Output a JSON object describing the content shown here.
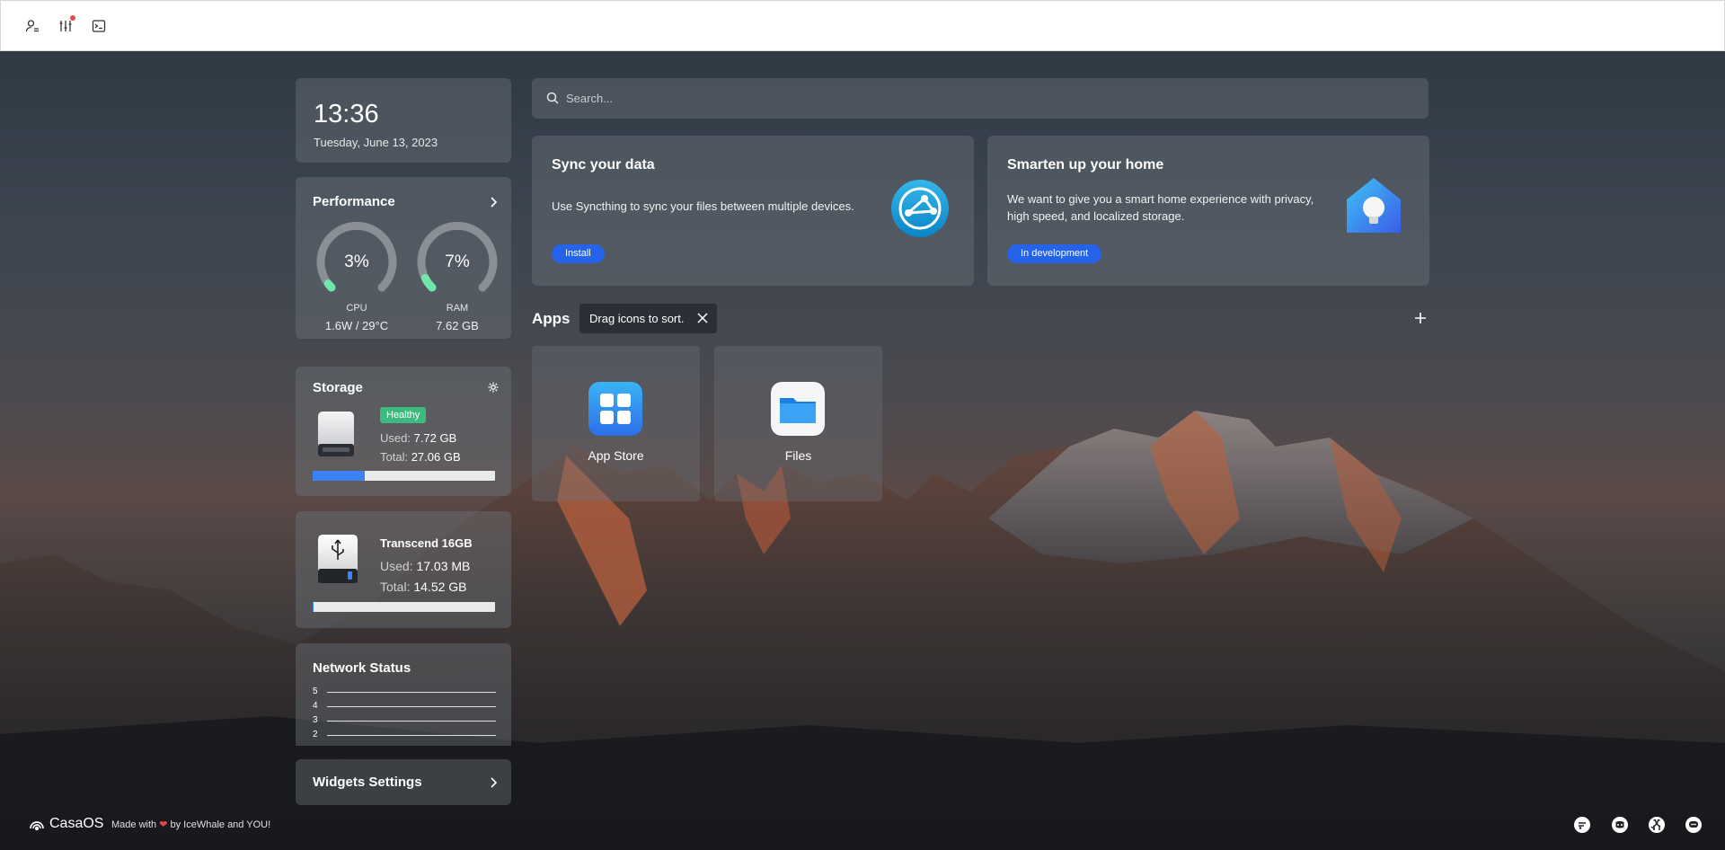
{
  "topbar": {
    "icons": [
      "user-settings-icon",
      "sliders-icon",
      "terminal-icon"
    ],
    "notification_dot": true
  },
  "clock": {
    "time": "13:36",
    "date": "Tuesday, June 13, 2023"
  },
  "performance": {
    "title": "Performance",
    "cpu": {
      "value": "3%",
      "label": "CPU",
      "sub": "1.6W / 29°C",
      "fraction": 0.03
    },
    "ram": {
      "value": "7%",
      "label": "RAM",
      "sub": "7.62 GB",
      "fraction": 0.07
    }
  },
  "storage": {
    "title": "Storage",
    "badge": "Healthy",
    "used_label": "Used:",
    "used": "7.72 GB",
    "total_label": "Total:",
    "total": "27.06 GB",
    "usage_fraction": 0.285
  },
  "usb": {
    "name": "Transcend 16GB",
    "used_label": "Used:",
    "used": "17.03 MB",
    "total_label": "Total:",
    "total": "14.52 GB",
    "usage_fraction": 0.001
  },
  "network": {
    "title": "Network Status",
    "axis_labels": [
      "5",
      "4",
      "3",
      "2"
    ]
  },
  "widgets_settings": {
    "title": "Widgets Settings"
  },
  "search": {
    "placeholder": "Search..."
  },
  "promos": [
    {
      "title": "Sync your data",
      "desc": "Use Syncthing to sync your files between multiple devices.",
      "button": "Install",
      "icon": "syncthing-icon"
    },
    {
      "title": "Smarten up your home",
      "desc": "We want to give you a smart home experience with privacy, high speed, and localized storage.",
      "button": "In development",
      "icon": "smart-home-icon"
    }
  ],
  "apps": {
    "title": "Apps",
    "tooltip": "Drag icons to sort.",
    "items": [
      {
        "label": "App Store",
        "icon": "app-store-icon"
      },
      {
        "label": "Files",
        "icon": "files-icon"
      }
    ]
  },
  "footer": {
    "brand": "CasaOS",
    "made_with": "Made with",
    "by": "by IceWhale and YOU!",
    "social_icons": [
      "discourse-icon",
      "discord-icon",
      "github-icon",
      "chat-icon"
    ]
  },
  "colors": {
    "accent": "#2563eb",
    "healthy": "#3dbb7e",
    "gauge_fill": "#6ee7a8",
    "gauge_track": "#8a8f95"
  }
}
